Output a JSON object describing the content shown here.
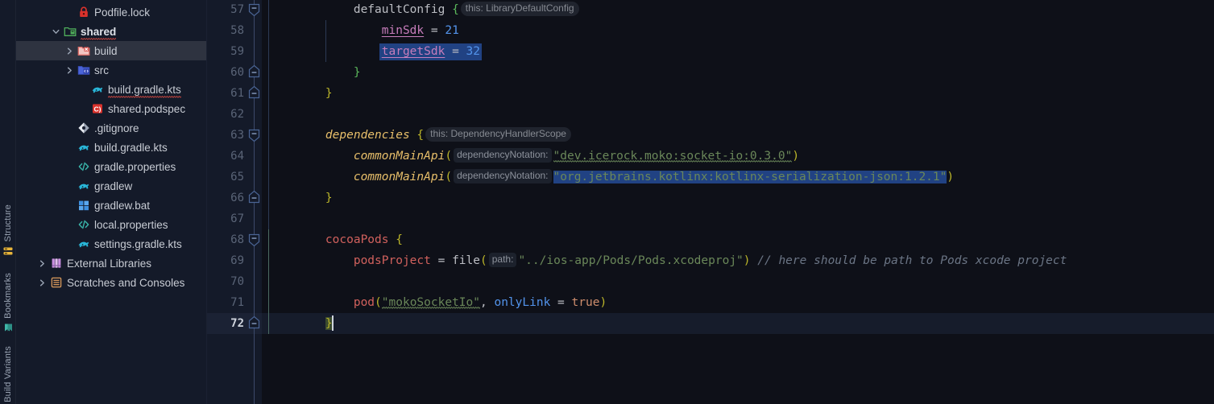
{
  "toolstrip": {
    "tools": [
      {
        "label": "Structure",
        "icon": "structure-icon",
        "color": "#e8b53a"
      },
      {
        "label": "Bookmarks",
        "icon": "bookmarks-icon",
        "color": "#3fb6a8"
      },
      {
        "label": "Build Variants",
        "icon": "build-variants-icon",
        "color": "#3fb6a8"
      }
    ]
  },
  "project_tree": {
    "items": [
      {
        "label": "Podfile.lock",
        "icon": "lock-icon",
        "indent": 3,
        "arrow": "none",
        "selected": false,
        "bold": false,
        "squiggly": false
      },
      {
        "label": "shared",
        "icon": "module-folder-icon",
        "indent": 2,
        "arrow": "expanded",
        "selected": false,
        "bold": true,
        "squiggly": true
      },
      {
        "label": "build",
        "icon": "excluded-folder-icon",
        "indent": 3,
        "arrow": "collapsed",
        "selected": true,
        "bold": false,
        "squiggly": false
      },
      {
        "label": "src",
        "icon": "source-folder-icon",
        "indent": 3,
        "arrow": "collapsed",
        "selected": false,
        "bold": false,
        "squiggly": false
      },
      {
        "label": "build.gradle.kts",
        "icon": "gradle-icon",
        "indent": 4,
        "arrow": "none",
        "selected": false,
        "bold": false,
        "squiggly": true
      },
      {
        "label": "shared.podspec",
        "icon": "podspec-icon",
        "indent": 4,
        "arrow": "none",
        "selected": false,
        "bold": false,
        "squiggly": false
      },
      {
        "label": ".gitignore",
        "icon": "git-icon",
        "indent": 3,
        "arrow": "none",
        "selected": false,
        "bold": false,
        "squiggly": false
      },
      {
        "label": "build.gradle.kts",
        "icon": "gradle-icon",
        "indent": 3,
        "arrow": "none",
        "selected": false,
        "bold": false,
        "squiggly": false
      },
      {
        "label": "gradle.properties",
        "icon": "xml-icon",
        "indent": 3,
        "arrow": "none",
        "selected": false,
        "bold": false,
        "squiggly": false
      },
      {
        "label": "gradlew",
        "icon": "gradle-icon",
        "indent": 3,
        "arrow": "none",
        "selected": false,
        "bold": false,
        "squiggly": false
      },
      {
        "label": "gradlew.bat",
        "icon": "windows-icon",
        "indent": 3,
        "arrow": "none",
        "selected": false,
        "bold": false,
        "squiggly": false
      },
      {
        "label": "local.properties",
        "icon": "xml-icon",
        "indent": 3,
        "arrow": "none",
        "selected": false,
        "bold": false,
        "squiggly": false
      },
      {
        "label": "settings.gradle.kts",
        "icon": "gradle-icon",
        "indent": 3,
        "arrow": "none",
        "selected": false,
        "bold": false,
        "squiggly": false
      },
      {
        "label": "External Libraries",
        "icon": "library-icon",
        "indent": 1,
        "arrow": "collapsed",
        "selected": false,
        "bold": false,
        "squiggly": false
      },
      {
        "label": "Scratches and Consoles",
        "icon": "scratches-icon",
        "indent": 1,
        "arrow": "collapsed",
        "selected": false,
        "bold": false,
        "squiggly": false
      }
    ]
  },
  "editor": {
    "first_line_number": 57,
    "current_line_number": 72,
    "line_numbers": [
      57,
      58,
      59,
      60,
      61,
      62,
      63,
      64,
      65,
      66,
      67,
      68,
      69,
      70,
      71,
      72
    ],
    "lines": [
      {
        "n": 57,
        "tokens": [
          {
            "t": "        ",
            "c": "tok-plain"
          },
          {
            "t": "defaultConfig ",
            "c": "tok-plain"
          },
          {
            "t": "{",
            "c": "tok-brace-g"
          },
          {
            "t": "this: LibraryDefaultConfig",
            "c": "inlay"
          }
        ]
      },
      {
        "n": 58,
        "tokens": [
          {
            "t": "            ",
            "c": "tok-plain"
          },
          {
            "t": "minSdk",
            "c": "tok-prop"
          },
          {
            "t": " = ",
            "c": "tok-plain"
          },
          {
            "t": "21",
            "c": "tok-num"
          }
        ]
      },
      {
        "n": 59,
        "selected_range": true,
        "tokens": [
          {
            "t": "            ",
            "c": "tok-plain"
          },
          {
            "t": "targetSdk",
            "c": "tok-prop"
          },
          {
            "t": " = ",
            "c": "tok-plain"
          },
          {
            "t": "32",
            "c": "tok-num"
          }
        ]
      },
      {
        "n": 60,
        "tokens": [
          {
            "t": "        ",
            "c": "tok-plain"
          },
          {
            "t": "}",
            "c": "tok-brace-g"
          }
        ]
      },
      {
        "n": 61,
        "tokens": [
          {
            "t": "    ",
            "c": "tok-plain"
          },
          {
            "t": "}",
            "c": "tok-brace"
          }
        ]
      },
      {
        "n": 62,
        "tokens": []
      },
      {
        "n": 63,
        "tokens": [
          {
            "t": "    ",
            "c": "tok-plain"
          },
          {
            "t": "dependencies ",
            "c": "tok-fn"
          },
          {
            "t": "{",
            "c": "tok-brace"
          },
          {
            "t": "this: DependencyHandlerScope",
            "c": "inlay"
          }
        ]
      },
      {
        "n": 64,
        "tokens": [
          {
            "t": "        ",
            "c": "tok-plain"
          },
          {
            "t": "commonMainApi",
            "c": "tok-fn"
          },
          {
            "t": "(",
            "c": "tok-brace"
          },
          {
            "t": "dependencyNotation:",
            "c": "inlay-param"
          },
          {
            "t": "\"dev.icerock.moko:socket-io:0.3.0\"",
            "c": "tok-str"
          },
          {
            "t": ")",
            "c": "tok-brace"
          }
        ]
      },
      {
        "n": 65,
        "tokens": [
          {
            "t": "        ",
            "c": "tok-plain"
          },
          {
            "t": "commonMainApi",
            "c": "tok-fn"
          },
          {
            "t": "(",
            "c": "tok-brace"
          },
          {
            "t": "dependencyNotation:",
            "c": "inlay-param"
          },
          {
            "t": "\"org.jetbrains.kotlinx:kotlinx-serialization-json:1.2.1\"",
            "c": "tok-str sel-hl"
          },
          {
            "t": ")",
            "c": "tok-brace"
          }
        ]
      },
      {
        "n": 66,
        "tokens": [
          {
            "t": "    ",
            "c": "tok-plain"
          },
          {
            "t": "}",
            "c": "tok-brace"
          }
        ]
      },
      {
        "n": 67,
        "tokens": []
      },
      {
        "n": 68,
        "tokens": [
          {
            "t": "    ",
            "c": "tok-plain"
          },
          {
            "t": "cocoaPods ",
            "c": "tok-err"
          },
          {
            "t": "{",
            "c": "tok-brace"
          }
        ]
      },
      {
        "n": 69,
        "tokens": [
          {
            "t": "        ",
            "c": "tok-plain"
          },
          {
            "t": "podsProject",
            "c": "tok-err"
          },
          {
            "t": " = ",
            "c": "tok-plain"
          },
          {
            "t": "file",
            "c": "tok-plain"
          },
          {
            "t": "(",
            "c": "tok-brace"
          },
          {
            "t": "path:",
            "c": "inlay-param"
          },
          {
            "t": "\"../ios-app/Pods/Pods.xcodeproj\"",
            "c": "tok-str"
          },
          {
            "t": ")",
            "c": "tok-brace"
          },
          {
            "t": " ",
            "c": "tok-plain"
          },
          {
            "t": "// here should be path to Pods xcode project",
            "c": "tok-cmt"
          }
        ]
      },
      {
        "n": 70,
        "tokens": []
      },
      {
        "n": 71,
        "tokens": [
          {
            "t": "        ",
            "c": "tok-plain"
          },
          {
            "t": "pod",
            "c": "tok-err"
          },
          {
            "t": "(",
            "c": "tok-brace"
          },
          {
            "t": "\"mokoSocketIo\"",
            "c": "tok-str"
          },
          {
            "t": ", ",
            "c": "tok-plain"
          },
          {
            "t": "onlyLink",
            "c": "tok-param"
          },
          {
            "t": " = ",
            "c": "tok-plain"
          },
          {
            "t": "true",
            "c": "tok-kw"
          },
          {
            "t": ")",
            "c": "tok-brace"
          }
        ]
      },
      {
        "n": 72,
        "current": true,
        "tokens": [
          {
            "t": "    ",
            "c": "tok-plain"
          },
          {
            "t": "}",
            "c": "tok-brace brace-match"
          },
          {
            "t": "",
            "c": "caret"
          }
        ]
      }
    ]
  },
  "colors": {
    "editor_bg": "#0e1018",
    "gutter_bg": "#141a29",
    "sidebar_bg": "#141a29",
    "selection": "#214283",
    "tree_selected": "#2e3340",
    "accent_string": "#6a8759",
    "accent_error": "#d1615d",
    "accent_brace": "#bbb529",
    "accent_fn": "#e8bf6a",
    "accent_number": "#5394ec",
    "accent_property": "#c77dbb",
    "comment": "#6b7585"
  }
}
